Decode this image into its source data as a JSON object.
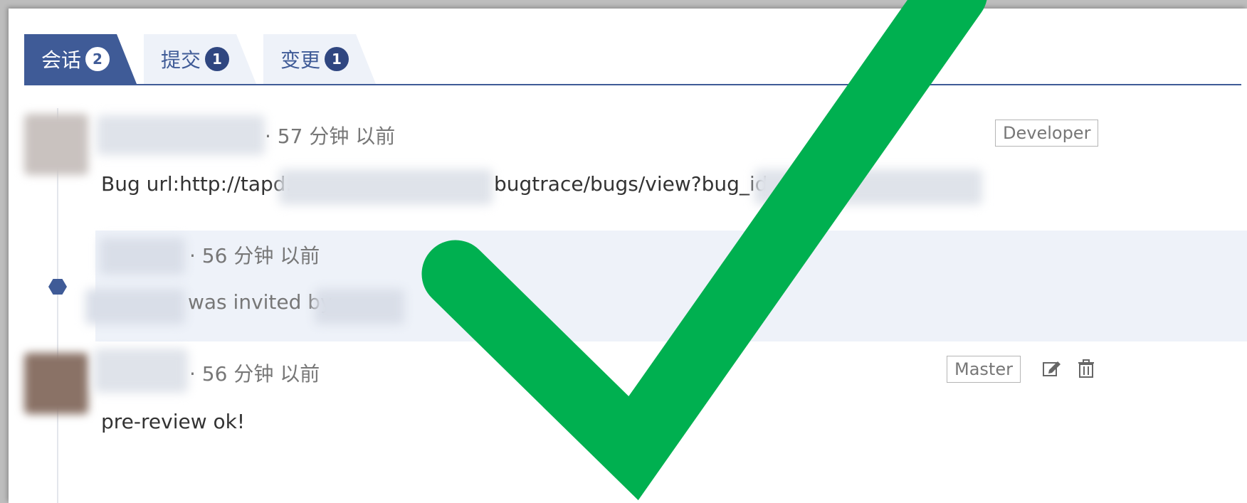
{
  "tabs": [
    {
      "label": "会话",
      "count": "2",
      "active": true
    },
    {
      "label": "提交",
      "count": "1",
      "active": false
    },
    {
      "label": "变更",
      "count": "1",
      "active": false
    }
  ],
  "comments": [
    {
      "time": "· 57 分钟 以前",
      "role": "Developer",
      "body_prefix": "Bug url:http://tapd.",
      "body_middle": "bugtrace/bugs/view?bug_id="
    },
    {
      "time": "· 56 分钟 以前",
      "body_middle": "was invited by"
    },
    {
      "time": "· 56 分钟 以前",
      "role": "Master",
      "body": "pre-review ok!"
    }
  ],
  "icons": {
    "edit": "edit-icon",
    "delete": "trash-icon",
    "overlay": "checkmark-icon"
  },
  "colors": {
    "accent": "#3f5b97",
    "checkmark": "#00b050"
  }
}
